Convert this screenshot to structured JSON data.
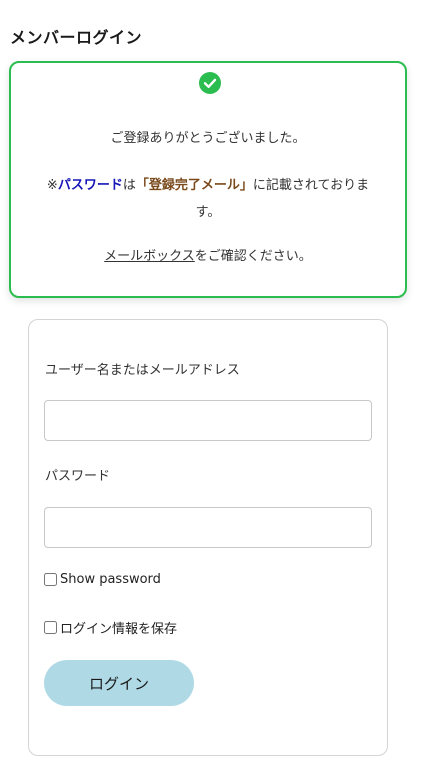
{
  "page": {
    "title": "メンバーログイン"
  },
  "notice": {
    "icon": "check-circle-icon",
    "accent_color": "#2bbd4f",
    "line1": "ご登録ありがとうございました。",
    "line2_prefix": "※",
    "line2_password": "パスワード",
    "line2_wa": "は",
    "line2_mail": "「登録完了メール」",
    "line2_suffix": "に記載されておりま",
    "line3": "す。",
    "mailbox_link": "メールボックス",
    "line4_suffix": "をご確認ください。"
  },
  "form": {
    "username_label": "ユーザー名またはメールアドレス",
    "username_value": "",
    "password_label": "パスワード",
    "password_value": "",
    "show_password_label": "Show password",
    "show_password_checked": false,
    "remember_label": "ログイン情報を保存",
    "remember_checked": false,
    "login_button": "ログイン",
    "button_color": "#b0d9e6"
  }
}
